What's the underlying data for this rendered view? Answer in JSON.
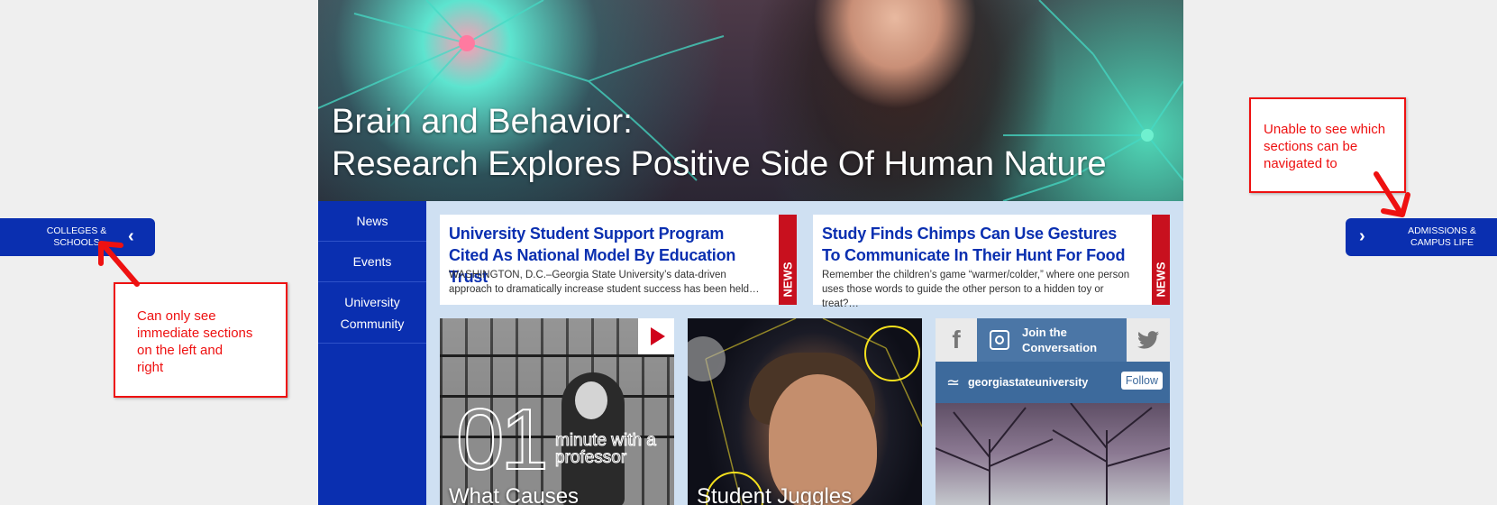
{
  "hero": {
    "title_line1": "Brain and Behavior:",
    "title_line2": "Research Explores Positive Side Of Human Nature"
  },
  "left_nav": {
    "items": [
      {
        "label": "News"
      },
      {
        "label": "Events"
      },
      {
        "label": "University Community"
      }
    ]
  },
  "news": [
    {
      "headline": "University Student Support Program Cited As National Model By Education Trust",
      "excerpt": "WASHINGTON, D.C.–Georgia State University’s data-driven approach to dramatically increase student success has been held…",
      "tag": "NEWS"
    },
    {
      "headline": "Study Finds Chimps Can Use Gestures To Communicate In Their Hunt For Food",
      "excerpt": "Remember the children’s game “warmer/colder,” where one person uses those words to guide the other person to a hidden toy or treat?…",
      "tag": "NEWS"
    }
  ],
  "tiles": [
    {
      "number": "01",
      "overlay": "minute with a professor",
      "caption": "What Causes",
      "icon": "play-icon"
    },
    {
      "caption": "Student Juggles"
    }
  ],
  "social": {
    "facebook_icon": "facebook-icon",
    "instagram_icon": "instagram-icon",
    "twitter_icon": "twitter-icon",
    "join_line1": "Join the",
    "join_line2": "Conversation",
    "account": "georgiastateuniversity",
    "follow_label": "Follow"
  },
  "side_tabs": {
    "left_line1": "COLLEGES &",
    "left_line2": "SCHOOLS",
    "right_line1": "ADMISSIONS &",
    "right_line2": "CAMPUS LIFE"
  },
  "annotations": {
    "left_lines": [
      "Can only see",
      "immediate sections",
      "on the left and",
      "right"
    ],
    "right_lines": [
      "Unable to see which",
      "sections can be",
      "navigated to"
    ]
  },
  "colors": {
    "nav_blue": "#0a2fb0",
    "news_red": "#c8101e",
    "annotation_red": "#ee1111",
    "social_blue": "#4b76a6"
  }
}
